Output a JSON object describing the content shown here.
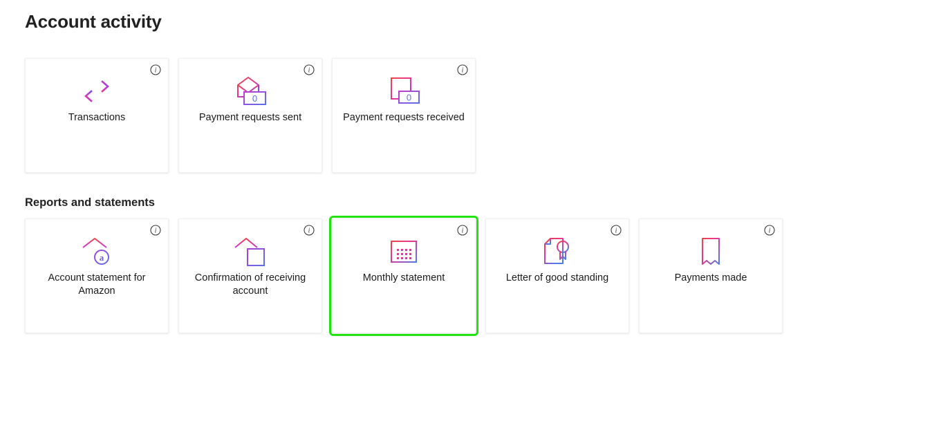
{
  "page": {
    "title": "Account activity",
    "background_color": "#ffffff",
    "text_color": "#1a1a1a",
    "selection_color": "#22e310"
  },
  "sections": [
    {
      "id": "activity",
      "title": "",
      "cards": [
        {
          "label": "Transactions",
          "icon": "transfer-arrows-icon",
          "badge": "",
          "info_icon": "info-circle-icon",
          "selected": false
        },
        {
          "label": "Payment requests sent",
          "icon": "envelope-with-amount-icon",
          "badge": "0",
          "info_icon": "info-circle-icon",
          "selected": false
        },
        {
          "label": "Payment requests received",
          "icon": "document-with-amount-icon",
          "badge": "0",
          "info_icon": "info-circle-icon",
          "selected": false
        }
      ]
    },
    {
      "id": "reports",
      "title": "Reports and statements",
      "cards": [
        {
          "label": "Account statement for Amazon",
          "icon": "bank-with-amazon-badge-icon",
          "badge": "a",
          "info_icon": "info-circle-icon",
          "selected": false
        },
        {
          "label": "Confirmation of receiving account",
          "icon": "bank-with-document-icon",
          "badge": "",
          "info_icon": "info-circle-icon",
          "selected": false
        },
        {
          "label": "Monthly statement",
          "icon": "calendar-icon",
          "badge": "",
          "info_icon": "info-circle-icon",
          "selected": true
        },
        {
          "label": "Letter of good standing",
          "icon": "document-with-seal-icon",
          "badge": "",
          "info_icon": "info-circle-icon",
          "selected": false
        },
        {
          "label": "Payments made",
          "icon": "receipt-icon",
          "badge": "",
          "info_icon": "info-circle-icon",
          "selected": false
        }
      ]
    }
  ]
}
